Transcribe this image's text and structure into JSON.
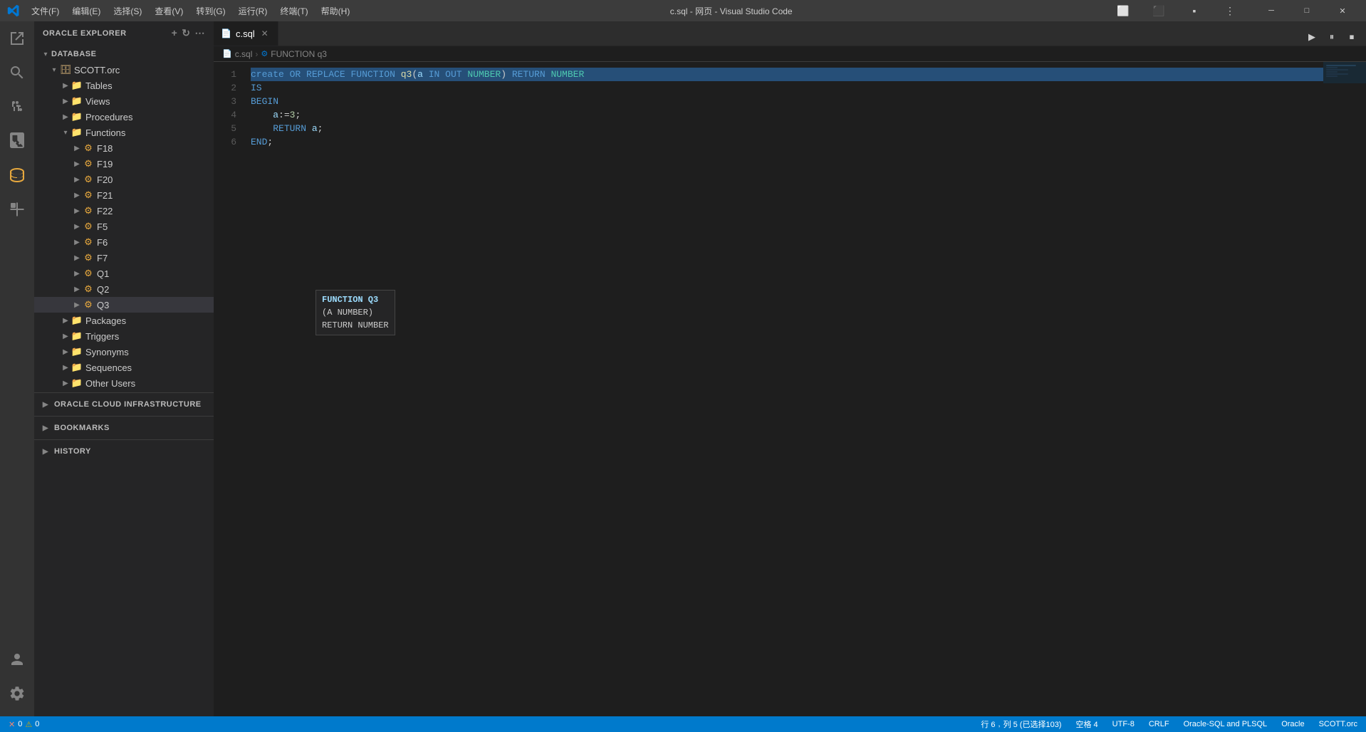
{
  "titleBar": {
    "title": "c.sql - 网页 - Visual Studio Code",
    "menus": [
      "文件(F)",
      "编辑(E)",
      "选择(S)",
      "查看(V)",
      "转到(G)",
      "运行(R)",
      "终端(T)",
      "帮助(H)"
    ]
  },
  "sidebar": {
    "header": "ORACLE EXPLORER",
    "database_section": "DATABASE",
    "tree": {
      "root": "SCOTT.orc",
      "nodes": [
        {
          "id": "tables",
          "label": "Tables",
          "level": 1,
          "expanded": false
        },
        {
          "id": "views",
          "label": "Views",
          "level": 1,
          "expanded": false
        },
        {
          "id": "procedures",
          "label": "Procedures",
          "level": 1,
          "expanded": false
        },
        {
          "id": "functions",
          "label": "Functions",
          "level": 1,
          "expanded": true
        },
        {
          "id": "f18",
          "label": "F18",
          "level": 2,
          "expanded": false
        },
        {
          "id": "f19",
          "label": "F19",
          "level": 2,
          "expanded": false
        },
        {
          "id": "f20",
          "label": "F20",
          "level": 2,
          "expanded": false
        },
        {
          "id": "f21",
          "label": "F21",
          "level": 2,
          "expanded": false
        },
        {
          "id": "f22",
          "label": "F22",
          "level": 2,
          "expanded": false
        },
        {
          "id": "f5",
          "label": "F5",
          "level": 2,
          "expanded": false
        },
        {
          "id": "f6",
          "label": "F6",
          "level": 2,
          "expanded": false
        },
        {
          "id": "f7",
          "label": "F7",
          "level": 2,
          "expanded": false
        },
        {
          "id": "q1",
          "label": "Q1",
          "level": 2,
          "expanded": false
        },
        {
          "id": "q2",
          "label": "Q2",
          "level": 2,
          "expanded": false
        },
        {
          "id": "q3",
          "label": "Q3",
          "level": 2,
          "expanded": false,
          "selected": true
        },
        {
          "id": "packages",
          "label": "Packages",
          "level": 1,
          "expanded": false
        },
        {
          "id": "triggers",
          "label": "Triggers",
          "level": 1,
          "expanded": false
        },
        {
          "id": "synonyms",
          "label": "Synonyms",
          "level": 1,
          "expanded": false
        },
        {
          "id": "sequences",
          "label": "Sequences",
          "level": 1,
          "expanded": false
        },
        {
          "id": "otherusers",
          "label": "Other Users",
          "level": 1,
          "expanded": false
        }
      ]
    },
    "bottom_sections": [
      {
        "id": "oracle-cloud",
        "label": "ORACLE CLOUD INFRASTRUCTURE"
      },
      {
        "id": "bookmarks",
        "label": "BOOKMARKS"
      },
      {
        "id": "history",
        "label": "HISTORY"
      }
    ]
  },
  "tab": {
    "filename": "c.sql",
    "icon": "📄"
  },
  "breadcrumb": {
    "file": "c.sql",
    "item": "FUNCTION q3"
  },
  "editor": {
    "lines": [
      {
        "num": 1,
        "content": "create OR REPLACE FUNCTION q3(a IN OUT NUMBER) RETURN NUMBER"
      },
      {
        "num": 2,
        "content": "IS"
      },
      {
        "num": 3,
        "content": "BEGIN"
      },
      {
        "num": 4,
        "content": "    a:=3;"
      },
      {
        "num": 5,
        "content": "    RETURN a;"
      },
      {
        "num": 6,
        "content": "END;"
      }
    ]
  },
  "tooltip": {
    "title": "FUNCTION Q3",
    "param": "(A NUMBER)",
    "return": "RETURN NUMBER"
  },
  "statusBar": {
    "errors": "0",
    "warnings": "0",
    "line": "行 6",
    "col": "列 5 (已选择103)",
    "spaces": "空格 4",
    "encoding": "UTF-8",
    "lineending": "CRLF",
    "language": "Oracle-SQL and PLSQL",
    "branch": "Oracle",
    "schema": "SCOTT.orc"
  }
}
